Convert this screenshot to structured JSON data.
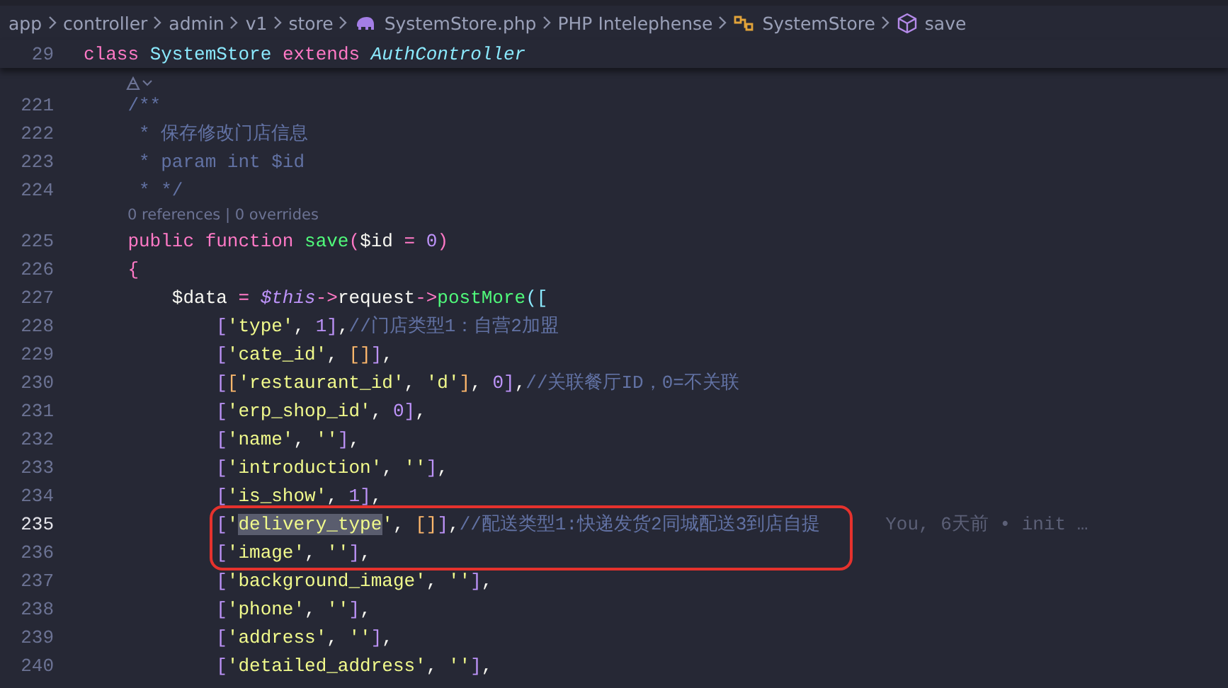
{
  "breadcrumbs": [
    {
      "text": "app"
    },
    {
      "text": "controller"
    },
    {
      "text": "admin"
    },
    {
      "text": "v1"
    },
    {
      "text": "store"
    },
    {
      "text": "SystemStore.php",
      "kind": "file"
    },
    {
      "text": "PHP Intelephense"
    },
    {
      "text": "SystemStore",
      "kind": "class"
    },
    {
      "text": "save",
      "kind": "method"
    }
  ],
  "sticky": {
    "number": "29",
    "tokens": [
      {
        "kind": "keyword",
        "text": "class "
      },
      {
        "kind": "class",
        "text": "SystemStore "
      },
      {
        "kind": "keyword",
        "text": "extends "
      },
      {
        "kind": "italic-class",
        "text": "AuthController"
      }
    ]
  },
  "lines": [
    {
      "kind": "code",
      "number": "221",
      "current": false,
      "boxed": false,
      "tokens": [
        {
          "kind": "comment",
          "text": "    /**"
        }
      ]
    },
    {
      "kind": "code",
      "number": "222",
      "current": false,
      "boxed": false,
      "tokens": [
        {
          "kind": "comment",
          "text": "     * 保存修改门店信息"
        }
      ]
    },
    {
      "kind": "code",
      "number": "223",
      "current": false,
      "boxed": false,
      "tokens": [
        {
          "kind": "comment",
          "text": "     * param int $id"
        }
      ]
    },
    {
      "kind": "code",
      "number": "224",
      "current": false,
      "boxed": false,
      "tokens": [
        {
          "kind": "comment",
          "text": "     * */"
        }
      ]
    },
    {
      "kind": "lens",
      "text": "0 references | 0 overrides"
    },
    {
      "kind": "code",
      "number": "225",
      "current": false,
      "boxed": false,
      "tokens": [
        {
          "kind": "keyword",
          "text": "    public function "
        },
        {
          "kind": "func",
          "text": "save"
        },
        {
          "kind": "keyword",
          "text": "("
        },
        {
          "kind": "plain",
          "text": "$id "
        },
        {
          "kind": "keyword",
          "text": "= "
        },
        {
          "kind": "number",
          "text": "0"
        },
        {
          "kind": "keyword",
          "text": ")"
        }
      ]
    },
    {
      "kind": "code",
      "number": "226",
      "current": false,
      "boxed": false,
      "tokens": [
        {
          "kind": "keyword",
          "text": "    {"
        }
      ]
    },
    {
      "kind": "code",
      "number": "227",
      "current": false,
      "boxed": false,
      "tokens": [
        {
          "kind": "plain",
          "text": "        $data "
        },
        {
          "kind": "keyword",
          "text": "= "
        },
        {
          "kind": "this",
          "text": "$this"
        },
        {
          "kind": "keyword",
          "text": "->"
        },
        {
          "kind": "plain",
          "text": "request"
        },
        {
          "kind": "keyword",
          "text": "->"
        },
        {
          "kind": "func",
          "text": "postMore"
        },
        {
          "kind": "cyan",
          "text": "(["
        }
      ]
    },
    {
      "kind": "code",
      "number": "228",
      "current": false,
      "boxed": false,
      "tokens": [
        {
          "kind": "bracket",
          "text": "            ["
        },
        {
          "kind": "string",
          "text": "'type'"
        },
        {
          "kind": "plain",
          "text": ", "
        },
        {
          "kind": "number",
          "text": "1"
        },
        {
          "kind": "bracket",
          "text": "]"
        },
        {
          "kind": "plain",
          "text": ","
        },
        {
          "kind": "comment",
          "text": "//门店类型1：自营2加盟"
        }
      ]
    },
    {
      "kind": "code",
      "number": "229",
      "current": false,
      "boxed": false,
      "tokens": [
        {
          "kind": "bracket",
          "text": "            ["
        },
        {
          "kind": "string",
          "text": "'cate_id'"
        },
        {
          "kind": "plain",
          "text": ", "
        },
        {
          "kind": "orange",
          "text": "[]"
        },
        {
          "kind": "bracket",
          "text": "]"
        },
        {
          "kind": "plain",
          "text": ","
        }
      ]
    },
    {
      "kind": "code",
      "number": "230",
      "current": false,
      "boxed": false,
      "tokens": [
        {
          "kind": "bracket",
          "text": "            ["
        },
        {
          "kind": "orange",
          "text": "["
        },
        {
          "kind": "string",
          "text": "'restaurant_id'"
        },
        {
          "kind": "plain",
          "text": ", "
        },
        {
          "kind": "string",
          "text": "'d'"
        },
        {
          "kind": "orange",
          "text": "]"
        },
        {
          "kind": "plain",
          "text": ", "
        },
        {
          "kind": "number",
          "text": "0"
        },
        {
          "kind": "bracket",
          "text": "]"
        },
        {
          "kind": "plain",
          "text": ","
        },
        {
          "kind": "comment",
          "text": "//关联餐厅ID，0=不关联"
        }
      ]
    },
    {
      "kind": "code",
      "number": "231",
      "current": false,
      "boxed": false,
      "tokens": [
        {
          "kind": "bracket",
          "text": "            ["
        },
        {
          "kind": "string",
          "text": "'erp_shop_id'"
        },
        {
          "kind": "plain",
          "text": ", "
        },
        {
          "kind": "number",
          "text": "0"
        },
        {
          "kind": "bracket",
          "text": "]"
        },
        {
          "kind": "plain",
          "text": ","
        }
      ]
    },
    {
      "kind": "code",
      "number": "232",
      "current": false,
      "boxed": false,
      "tokens": [
        {
          "kind": "bracket",
          "text": "            ["
        },
        {
          "kind": "string",
          "text": "'name'"
        },
        {
          "kind": "plain",
          "text": ", "
        },
        {
          "kind": "string",
          "text": "''"
        },
        {
          "kind": "bracket",
          "text": "]"
        },
        {
          "kind": "plain",
          "text": ","
        }
      ]
    },
    {
      "kind": "code",
      "number": "233",
      "current": false,
      "boxed": false,
      "tokens": [
        {
          "kind": "bracket",
          "text": "            ["
        },
        {
          "kind": "string",
          "text": "'introduction'"
        },
        {
          "kind": "plain",
          "text": ", "
        },
        {
          "kind": "string",
          "text": "''"
        },
        {
          "kind": "bracket",
          "text": "]"
        },
        {
          "kind": "plain",
          "text": ","
        }
      ]
    },
    {
      "kind": "code",
      "number": "234",
      "current": false,
      "boxed": false,
      "tokens": [
        {
          "kind": "bracket",
          "text": "            ["
        },
        {
          "kind": "string",
          "text": "'is_show'"
        },
        {
          "kind": "plain",
          "text": ", "
        },
        {
          "kind": "number",
          "text": "1"
        },
        {
          "kind": "bracket",
          "text": "]"
        },
        {
          "kind": "plain",
          "text": ","
        }
      ]
    },
    {
      "kind": "code",
      "number": "235",
      "current": true,
      "boxed": true,
      "blame": "You, 6天前 • init …",
      "tokens": [
        {
          "kind": "bracket",
          "text": "            ["
        },
        {
          "kind": "string",
          "text": "'"
        },
        {
          "kind": "selected-string",
          "text": "delivery_type"
        },
        {
          "kind": "string",
          "text": "'"
        },
        {
          "kind": "plain",
          "text": ", "
        },
        {
          "kind": "orange",
          "text": "[]"
        },
        {
          "kind": "bracket",
          "text": "]"
        },
        {
          "kind": "plain",
          "text": ","
        },
        {
          "kind": "comment",
          "text": "//配送类型1:快递发货2同城配送3到店自提"
        }
      ]
    },
    {
      "kind": "code",
      "number": "236",
      "current": false,
      "boxed": true,
      "tokens": [
        {
          "kind": "bracket",
          "text": "            ["
        },
        {
          "kind": "string",
          "text": "'image'"
        },
        {
          "kind": "plain",
          "text": ", "
        },
        {
          "kind": "string",
          "text": "''"
        },
        {
          "kind": "bracket",
          "text": "]"
        },
        {
          "kind": "plain",
          "text": ","
        }
      ]
    },
    {
      "kind": "code",
      "number": "237",
      "current": false,
      "boxed": false,
      "tokens": [
        {
          "kind": "bracket",
          "text": "            ["
        },
        {
          "kind": "string",
          "text": "'background_image'"
        },
        {
          "kind": "plain",
          "text": ", "
        },
        {
          "kind": "string",
          "text": "''"
        },
        {
          "kind": "bracket",
          "text": "]"
        },
        {
          "kind": "plain",
          "text": ","
        }
      ]
    },
    {
      "kind": "code",
      "number": "238",
      "current": false,
      "boxed": false,
      "tokens": [
        {
          "kind": "bracket",
          "text": "            ["
        },
        {
          "kind": "string",
          "text": "'phone'"
        },
        {
          "kind": "plain",
          "text": ", "
        },
        {
          "kind": "string",
          "text": "''"
        },
        {
          "kind": "bracket",
          "text": "]"
        },
        {
          "kind": "plain",
          "text": ","
        }
      ]
    },
    {
      "kind": "code",
      "number": "239",
      "current": false,
      "boxed": false,
      "tokens": [
        {
          "kind": "bracket",
          "text": "            ["
        },
        {
          "kind": "string",
          "text": "'address'"
        },
        {
          "kind": "plain",
          "text": ", "
        },
        {
          "kind": "string",
          "text": "''"
        },
        {
          "kind": "bracket",
          "text": "]"
        },
        {
          "kind": "plain",
          "text": ","
        }
      ]
    },
    {
      "kind": "code",
      "number": "240",
      "current": false,
      "boxed": false,
      "tokens": [
        {
          "kind": "bracket",
          "text": "            ["
        },
        {
          "kind": "string",
          "text": "'detailed_address'"
        },
        {
          "kind": "plain",
          "text": ", "
        },
        {
          "kind": "string",
          "text": "''"
        },
        {
          "kind": "bracket",
          "text": "]"
        },
        {
          "kind": "plain",
          "text": ","
        }
      ]
    }
  ]
}
